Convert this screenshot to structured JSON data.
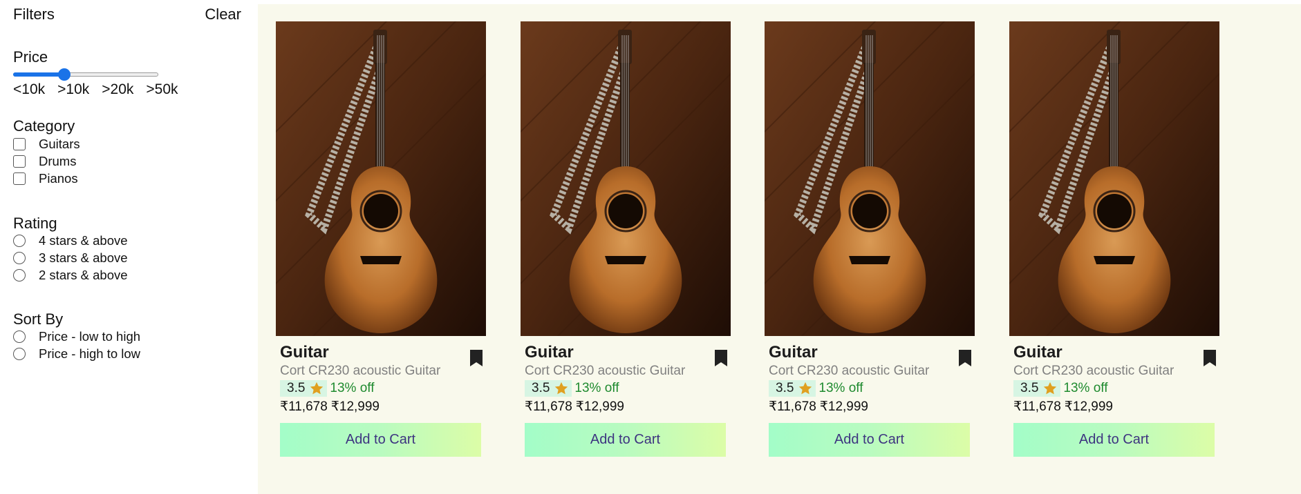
{
  "filters": {
    "title": "Filters",
    "clear_label": "Clear",
    "price": {
      "title": "Price",
      "slider_fraction": 0.35,
      "labels": [
        "<10k",
        ">10k",
        ">20k",
        ">50k"
      ]
    },
    "category": {
      "title": "Category",
      "options": [
        "Guitars",
        "Drums",
        "Pianos"
      ]
    },
    "rating": {
      "title": "Rating",
      "options": [
        "4 stars & above",
        "3 stars & above",
        "2 stars & above"
      ]
    },
    "sort": {
      "title": "Sort By",
      "options": [
        "Price - low to high",
        "Price - high to low"
      ]
    }
  },
  "products": [
    {
      "title": "Guitar",
      "description": "Cort CR230 acoustic Guitar",
      "rating": "3.5",
      "discount": "13% off",
      "price": "₹11,678",
      "original_price": "₹12,999",
      "cart_label": "Add to Cart"
    },
    {
      "title": "Guitar",
      "description": "Cort CR230 acoustic Guitar",
      "rating": "3.5",
      "discount": "13% off",
      "price": "₹11,678",
      "original_price": "₹12,999",
      "cart_label": "Add to Cart"
    },
    {
      "title": "Guitar",
      "description": "Cort CR230 acoustic Guitar",
      "rating": "3.5",
      "discount": "13% off",
      "price": "₹11,678",
      "original_price": "₹12,999",
      "cart_label": "Add to Cart"
    },
    {
      "title": "Guitar",
      "description": "Cort CR230 acoustic Guitar",
      "rating": "3.5",
      "discount": "13% off",
      "price": "₹11,678",
      "original_price": "₹12,999",
      "cart_label": "Add to Cart"
    }
  ],
  "colors": {
    "main_bg": "#f9f9ec",
    "slider_accent": "#1a73e8",
    "discount_green": "#1e8a2e",
    "rating_badge_bg": "#d7f5e3",
    "cart_text": "#3d3480",
    "star": "#e0a020"
  },
  "icons": {
    "bookmark": "bookmark-icon",
    "star": "star-icon",
    "product_image": "acoustic-guitar-photo"
  }
}
